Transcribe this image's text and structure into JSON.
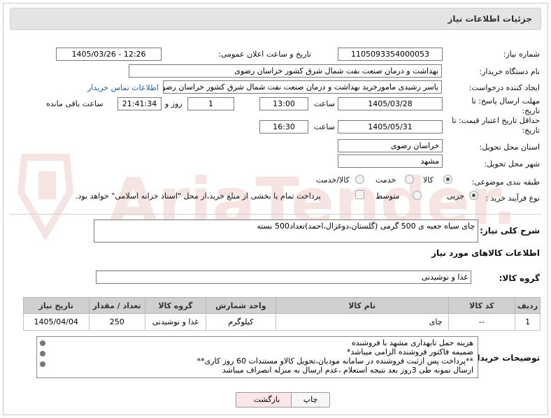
{
  "header": {
    "title": "جزئیات اطلاعات نیاز"
  },
  "fields": {
    "need_number_label": "شماره نیاز:",
    "need_number": "1105093354000053",
    "announce_label": "تاریخ و ساعت اعلان عمومی:",
    "announce_value": "1405/03/26 - 12:26",
    "buyer_org_label": "نام دستگاه خریدار:",
    "buyer_org": "بهداشت و درمان صنعت نفت شمال شرق کشور   خراسان رضوی",
    "creator_label": "ایجاد کننده درخواست:",
    "creator": "یاسر رشیدی مامورخرید بهداشت و درمان صنعت نفت شمال شرق کشور   خراسان رضوی",
    "contact_link": "اطلاعات تماس خریدار",
    "deadline_label": "مهلت ارسال پاسخ: تا تاریخ:",
    "deadline_date": "1405/03/28",
    "time_label": "ساعت",
    "deadline_time": "13:00",
    "days_value": "1",
    "days_label": "روز و",
    "remaining_time": "21:41:34",
    "remaining_label": "ساعت باقی مانده",
    "price_valid_label": "حداقل تاریخ اعتبار قیمت: تا تاریخ:",
    "price_valid_date": "1405/05/31",
    "price_valid_time": "16:30",
    "province_label": "استان محل تحویل:",
    "province": "خراسان رضوی",
    "city_label": "شهر محل تحویل:",
    "city": "مشهد",
    "category_label": "طبقه بندی موضوعی:",
    "category_options": [
      "کالا",
      "خدمت",
      "کالا/خدمت"
    ],
    "process_label": "نوع فرآیند خرید :",
    "process_options": [
      "جزیی",
      "متوسط"
    ],
    "payment_note": "پرداخت تمام یا بخشی از مبلغ خرید،از محل \"اسناد خزانه اسلامی\" خواهد بود."
  },
  "description": {
    "label": "شرح کلی نیاز:",
    "value": "چای سیاه جعبه ی 500 گرمی (گلستان،دوغزال،احمد)تعداد500 بسته"
  },
  "goods_section": {
    "title": "اطلاعات کالاهای مورد نیاز",
    "group_label": "گروه کالا:",
    "group_value": "غذا و نوشیدنی"
  },
  "table": {
    "headers": [
      "ردیف",
      "کد کالا",
      "نام کالا",
      "واحد شمارش",
      "گروه کالا",
      "تعداد / مقدار",
      "تاریخ نیاز"
    ],
    "rows": [
      [
        "1",
        "--",
        "چای",
        "کیلوگرم",
        "غذا و نوشیدنی",
        "250",
        "1405/04/04"
      ]
    ]
  },
  "buyer_notes": {
    "label": "توضیحات خریدار:",
    "lines": [
      "هزینه حمل تابهداری مشهد با فروشنده",
      "ضمیمه فاکتور فروشنده الزامی میباشد*",
      "**پرداخت پس ازثبت فروشنده در سامانه مودیان،تحویل کالاو مستندات 60 روز کاری**",
      "ارسال نمونه طی 3روز بعد نتیجه استعلام ،عدم ارسال به منزله انصراف میباشد"
    ]
  },
  "buttons": {
    "print": "چاپ",
    "back": "بازگشت"
  },
  "watermark_text": "AriaTender.net",
  "colors": {
    "header_bg": "#e4e4e4",
    "link": "#1a62b3",
    "watermark": "#c0392b"
  },
  "icons": [
    "shield-logo-icon",
    "radio-icon",
    "checkbox-icon",
    "resize-grip-icon"
  ]
}
